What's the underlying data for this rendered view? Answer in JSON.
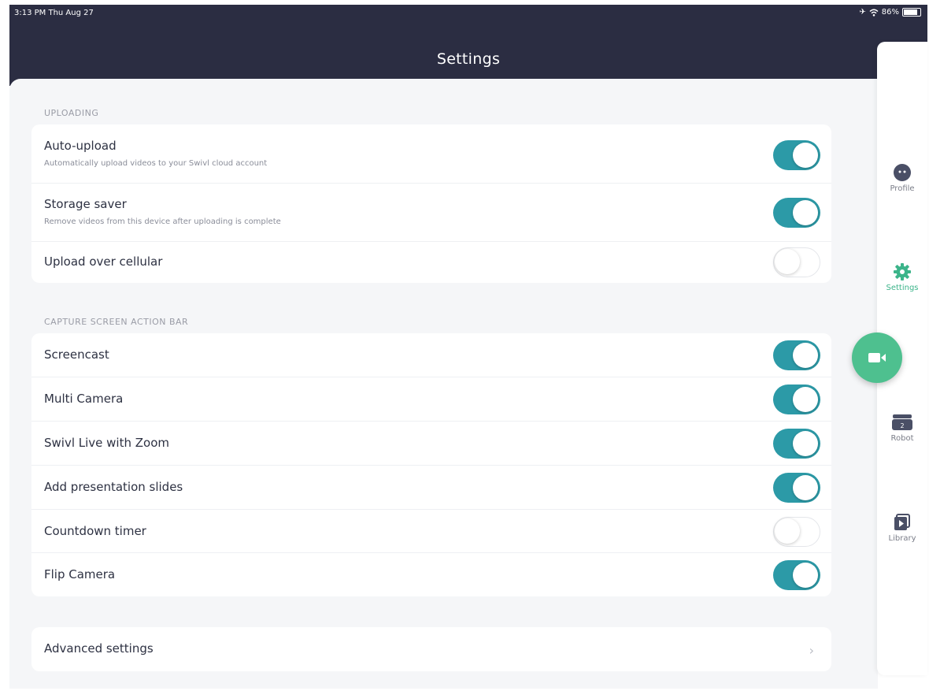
{
  "status_bar": {
    "time": "3:13 PM  Thu Aug 27",
    "battery": "86%",
    "battery_level": 0.86
  },
  "header": {
    "title": "Settings"
  },
  "sections": {
    "uploading": {
      "label": "UPLOADING",
      "rows": [
        {
          "title": "Auto-upload",
          "subtitle": "Automatically upload videos to your Swivl cloud account",
          "on": true
        },
        {
          "title": "Storage saver",
          "subtitle": "Remove videos from this device after uploading is complete",
          "on": true
        },
        {
          "title": "Upload over cellular",
          "on": false
        }
      ]
    },
    "capture": {
      "label": "CAPTURE SCREEN ACTION BAR",
      "rows": [
        {
          "title": "Screencast",
          "on": true
        },
        {
          "title": "Multi Camera",
          "on": true
        },
        {
          "title": "Swivl Live with Zoom",
          "on": true
        },
        {
          "title": "Add presentation slides",
          "on": true
        },
        {
          "title": "Countdown timer",
          "on": false
        },
        {
          "title": "Flip Camera",
          "on": true
        }
      ]
    },
    "advanced": {
      "label": "Advanced settings"
    }
  },
  "rail": {
    "items": [
      {
        "label": "Profile",
        "icon": "profile-icon"
      },
      {
        "label": "Settings",
        "icon": "gear-icon",
        "active": true
      },
      {
        "label": "Robot",
        "icon": "robot-icon"
      },
      {
        "label": "Library",
        "icon": "library-icon"
      }
    ],
    "record_icon": "video-camera-icon"
  },
  "colors": {
    "header": "#2b2d42",
    "toggle_on": "#2c9aa7",
    "accent_green": "#4ec08f",
    "background": "#f5f6f8"
  }
}
